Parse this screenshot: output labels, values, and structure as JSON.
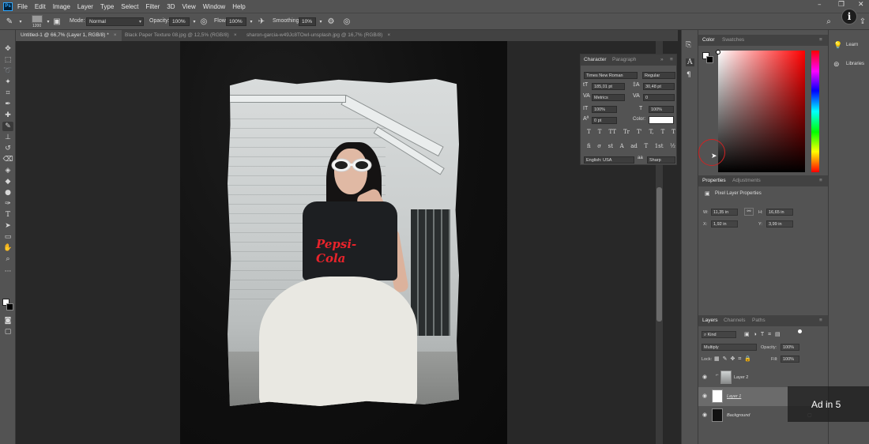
{
  "menu": {
    "items": [
      "File",
      "Edit",
      "Image",
      "Layer",
      "Type",
      "Select",
      "Filter",
      "3D",
      "View",
      "Window",
      "Help"
    ]
  },
  "options_bar": {
    "brush_size": "1200",
    "mode_label": "Mode:",
    "mode_value": "Normal",
    "opacity_label": "Opacity:",
    "opacity_value": "100%",
    "flow_label": "Flow:",
    "flow_value": "100%",
    "smoothing_label": "Smoothing:",
    "smoothing_value": "10%"
  },
  "tabs": [
    {
      "label": "Untitled-1 @ 66,7% (Layer 1, RGB/8) *",
      "active": true
    },
    {
      "label": "Black Paper Texture 08.jpg @ 12,5% (RGB/8)",
      "active": false
    },
    {
      "label": "sharon-garcia-w49Jc8TOwI-unsplash.jpg @ 16,7% (RGB/8)",
      "active": false
    }
  ],
  "photo": {
    "logo_text": "Pepsi-Cola"
  },
  "character_panel": {
    "tab_character": "Character",
    "tab_paragraph": "Paragraph",
    "font_family": "Times New Roman",
    "font_style": "Regular",
    "font_size": "185,01 pt",
    "leading": "30,48 pt",
    "kerning": "Metrics",
    "tracking": "0",
    "vertical_scale": "100%",
    "horizontal_scale": "100%",
    "baseline_shift": "0 pt",
    "color_label": "Color:",
    "language": "English: USA",
    "antialias": "Sharp",
    "type_buttons": [
      "T",
      "T",
      "TT",
      "Tr",
      "T'",
      "T,",
      "T",
      "T"
    ],
    "opentype_buttons": [
      "fi",
      "σ",
      "st",
      "A",
      "ad",
      "T",
      "1st",
      "½"
    ]
  },
  "color_panel": {
    "tab_color": "Color",
    "tab_swatches": "Swatches"
  },
  "properties_panel": {
    "tab_properties": "Properties",
    "tab_adjustments": "Adjustments",
    "title": "Pixel Layer Properties",
    "w_label": "W:",
    "w_value": "11,35 in",
    "h_label": "H:",
    "h_value": "16,65 in",
    "x_label": "X:",
    "x_value": "1,92 in",
    "y_label": "Y:",
    "y_value": "3,99 in"
  },
  "layers_panel": {
    "tab_layers": "Layers",
    "tab_channels": "Channels",
    "tab_paths": "Paths",
    "filter_kind": "Kind",
    "blend_mode": "Multiply",
    "opacity_label": "Opacity:",
    "opacity_value": "100%",
    "lock_label": "Lock:",
    "fill_label": "Fill:",
    "fill_value": "100%",
    "layers": [
      {
        "name": "Layer 2",
        "selected": false
      },
      {
        "name": "Layer 1",
        "selected": true
      },
      {
        "name": "Background",
        "selected": false
      }
    ]
  },
  "far_right": {
    "learn": "Learn",
    "libraries": "Libraries"
  },
  "overlay": {
    "info": "i",
    "ad": "Ad in 5"
  },
  "colors": {
    "accent_red": "#d02323",
    "ps_blue": "#31a8ff",
    "panel_bg": "#535353"
  }
}
